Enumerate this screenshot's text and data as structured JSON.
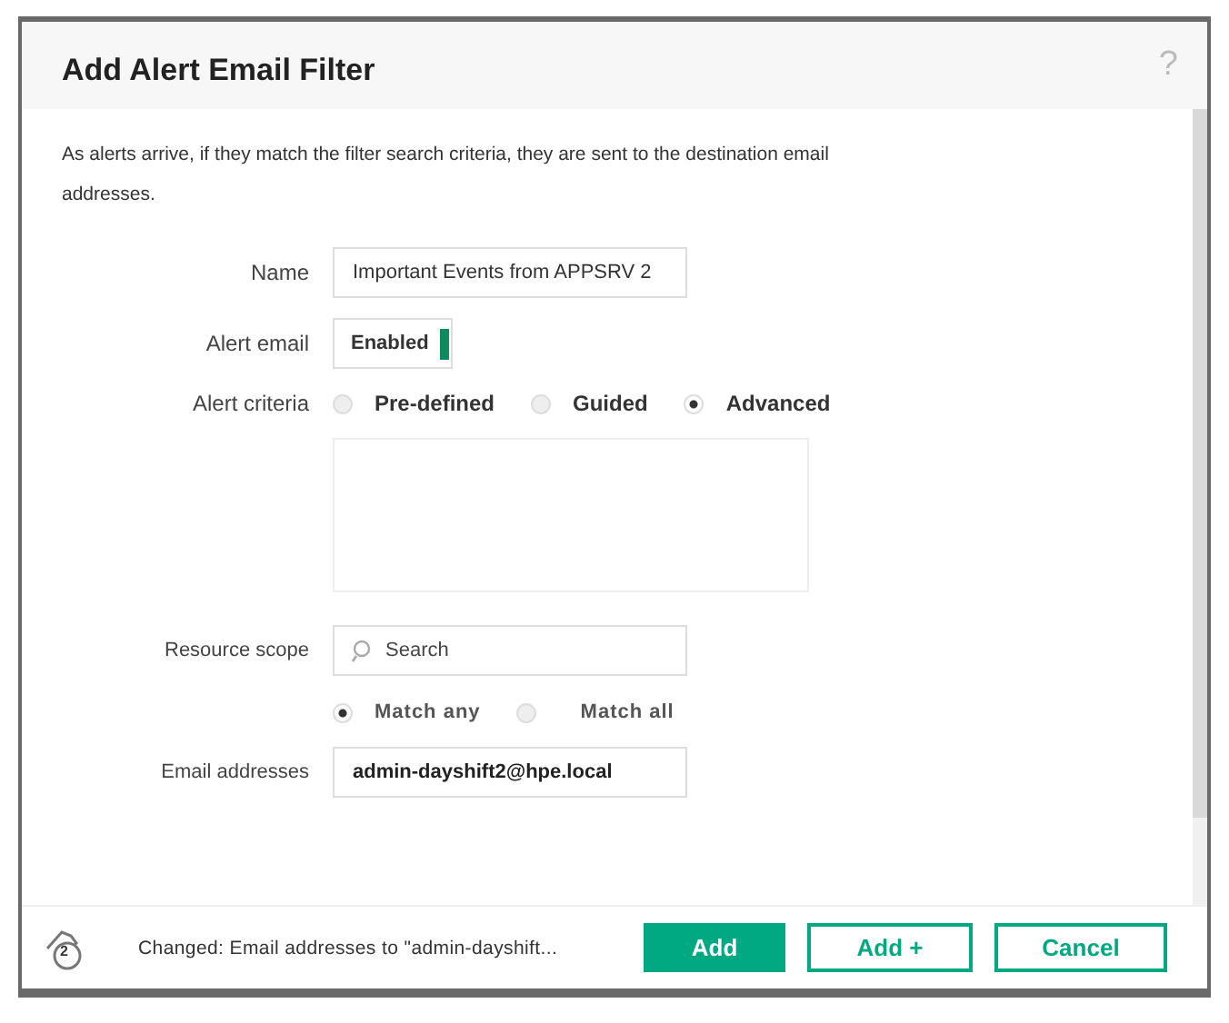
{
  "dialog": {
    "title": "Add Alert Email Filter",
    "help": "?"
  },
  "description": "As  alerts arrive, if they match the filter search criteria, they are sent to the destination email addresses.",
  "name_field": {
    "label": "Name",
    "value": "Important Events from APPSRV 2"
  },
  "alert_email": {
    "label": "Alert email",
    "text": "Enabled",
    "on": true
  },
  "alert_criteria": {
    "label": "Alert criteria",
    "options": [
      {
        "label": "Pre-defined",
        "selected": false
      },
      {
        "label": "Guided",
        "selected": false
      },
      {
        "label": "Advanced",
        "selected": true
      }
    ]
  },
  "resource_scope": {
    "label": "Resource scope",
    "placeholder": "Search",
    "match_options": [
      {
        "label": "Match any",
        "selected": true
      },
      {
        "label": "Match all",
        "selected": false
      }
    ]
  },
  "email_addresses": {
    "label": "Email addresses",
    "value": "admin-dayshift2@hpe.local"
  },
  "footer": {
    "change_count": "2",
    "status": "Changed: Email addresses to \"admin-dayshift...",
    "buttons": [
      {
        "label": "Add",
        "kind": "primary"
      },
      {
        "label": "Add +",
        "kind": "secondary"
      },
      {
        "label": "Cancel",
        "kind": "secondary"
      }
    ]
  }
}
